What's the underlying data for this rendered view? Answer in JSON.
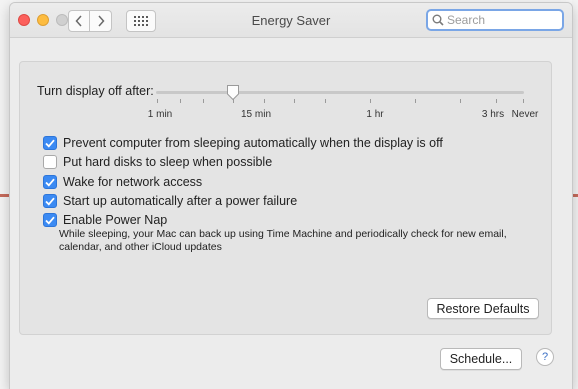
{
  "window": {
    "title": "Energy Saver"
  },
  "toolbar": {
    "search_placeholder": "Search"
  },
  "sleep_slider": {
    "label": "Turn display off after:",
    "ticks": [
      "1 min",
      "15 min",
      "1 hr",
      "3 hrs",
      "Never"
    ]
  },
  "options": [
    {
      "label": "Prevent computer from sleeping automatically when the display is off",
      "checked": true
    },
    {
      "label": "Put hard disks to sleep when possible",
      "checked": false
    },
    {
      "label": "Wake for network access",
      "checked": true
    },
    {
      "label": "Start up automatically after a power failure",
      "checked": true
    },
    {
      "label": "Enable Power Nap",
      "checked": true
    }
  ],
  "power_nap_description": "While sleeping, your Mac can back up using Time Machine and periodically check for new email, calendar, and other iCloud updates",
  "buttons": {
    "restore": "Restore Defaults",
    "schedule": "Schedule...",
    "help": "?"
  },
  "colors": {
    "accent": "#3b8af3",
    "close": "#fc605c",
    "minimize": "#fdbc40"
  },
  "icons": {
    "back": "chevron-left-icon",
    "forward": "chevron-right-icon",
    "grid": "grid-icon",
    "search": "search-icon",
    "check": "checkmark-icon"
  }
}
